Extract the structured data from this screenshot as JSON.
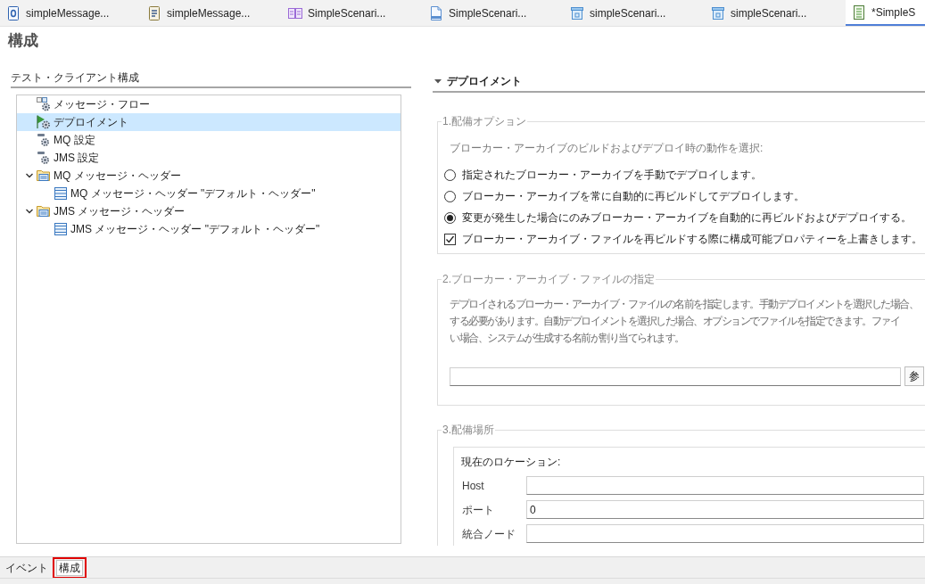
{
  "editor_tabs": [
    {
      "label": "simpleMessage...",
      "kind": "doc",
      "selected": false
    },
    {
      "label": "simpleMessage...",
      "kind": "page",
      "selected": false
    },
    {
      "label": "SimpleScenari...",
      "kind": "grid",
      "selected": false
    },
    {
      "label": "SimpleScenari...",
      "kind": "code",
      "selected": false
    },
    {
      "label": "simpleScenari...",
      "kind": "box",
      "selected": false
    },
    {
      "label": "simpleScenari...",
      "kind": "box",
      "selected": false
    },
    {
      "label": "*SimpleS",
      "kind": "sheet",
      "selected": true
    }
  ],
  "page_title": "構成",
  "tree": {
    "title": "テスト・クライアント構成",
    "items": [
      {
        "label": "メッセージ・フロー",
        "kind": "flow",
        "selected": false
      },
      {
        "label": "デプロイメント",
        "kind": "deploy",
        "selected": true
      },
      {
        "label": "MQ 設定",
        "kind": "settings",
        "selected": false
      },
      {
        "label": "JMS 設定",
        "kind": "settings",
        "selected": false
      },
      {
        "label": "MQ メッセージ・ヘッダー",
        "kind": "folder",
        "selected": false,
        "expanded": true,
        "children": [
          {
            "label": "MQ メッセージ・ヘッダー \"デフォルト・ヘッダー\"",
            "kind": "header",
            "selected": false
          }
        ]
      },
      {
        "label": "JMS メッセージ・ヘッダー",
        "kind": "folder",
        "selected": false,
        "expanded": true,
        "children": [
          {
            "label": "JMS メッセージ・ヘッダー \"デフォルト・ヘッダー\"",
            "kind": "header",
            "selected": false
          }
        ]
      }
    ]
  },
  "section": {
    "title": "デプロイメント",
    "expanded": true,
    "groups": [
      {
        "kind": "options",
        "legend": "1.配備オプション",
        "description": "ブローカー・アーカイブのビルドおよびデプロイ時の動作を選択:",
        "options": [
          {
            "kind": "radio",
            "label": "指定されたブローカー・アーカイブを手動でデプロイします。",
            "selected": false
          },
          {
            "kind": "radio",
            "label": "ブローカー・アーカイブを常に自動的に再ビルドしてデプロイします。",
            "selected": false
          },
          {
            "kind": "radio",
            "label": "変更が発生した場合にのみブローカー・アーカイブを自動的に再ビルドおよびデプロイする。",
            "selected": true
          },
          {
            "kind": "checkbox",
            "label": "ブローカー・アーカイブ・ファイルを再ビルドする際に構成可能プロパティーを上書きします。",
            "checked": true
          }
        ]
      },
      {
        "kind": "file",
        "legend": "2.ブローカー・アーカイブ・ファイルの指定",
        "description_lines": [
          "デプロイされるブローカー・アーカイブ・ファイルの名前を指定します。手動デプロイメントを選択した場合、",
          "する必要があります。自動デプロイメントを選択した場合、オプションでファイルを指定できます。ファイ",
          "い場合、システムが生成する名前が割り当てられます。"
        ],
        "browse_button": "参"
      },
      {
        "kind": "location",
        "legend": "3.配備場所",
        "subgroup": {
          "title": "現在のロケーション:",
          "fields": [
            {
              "label": "Host"
            },
            {
              "label": "ポート",
              "value": "0"
            },
            {
              "label": "統合ノード"
            }
          ]
        }
      }
    ]
  },
  "bottom_tabs": [
    {
      "label": "イベント",
      "selected": false,
      "highlighted": false
    },
    {
      "label": "構成",
      "selected": true,
      "highlighted": true
    }
  ]
}
